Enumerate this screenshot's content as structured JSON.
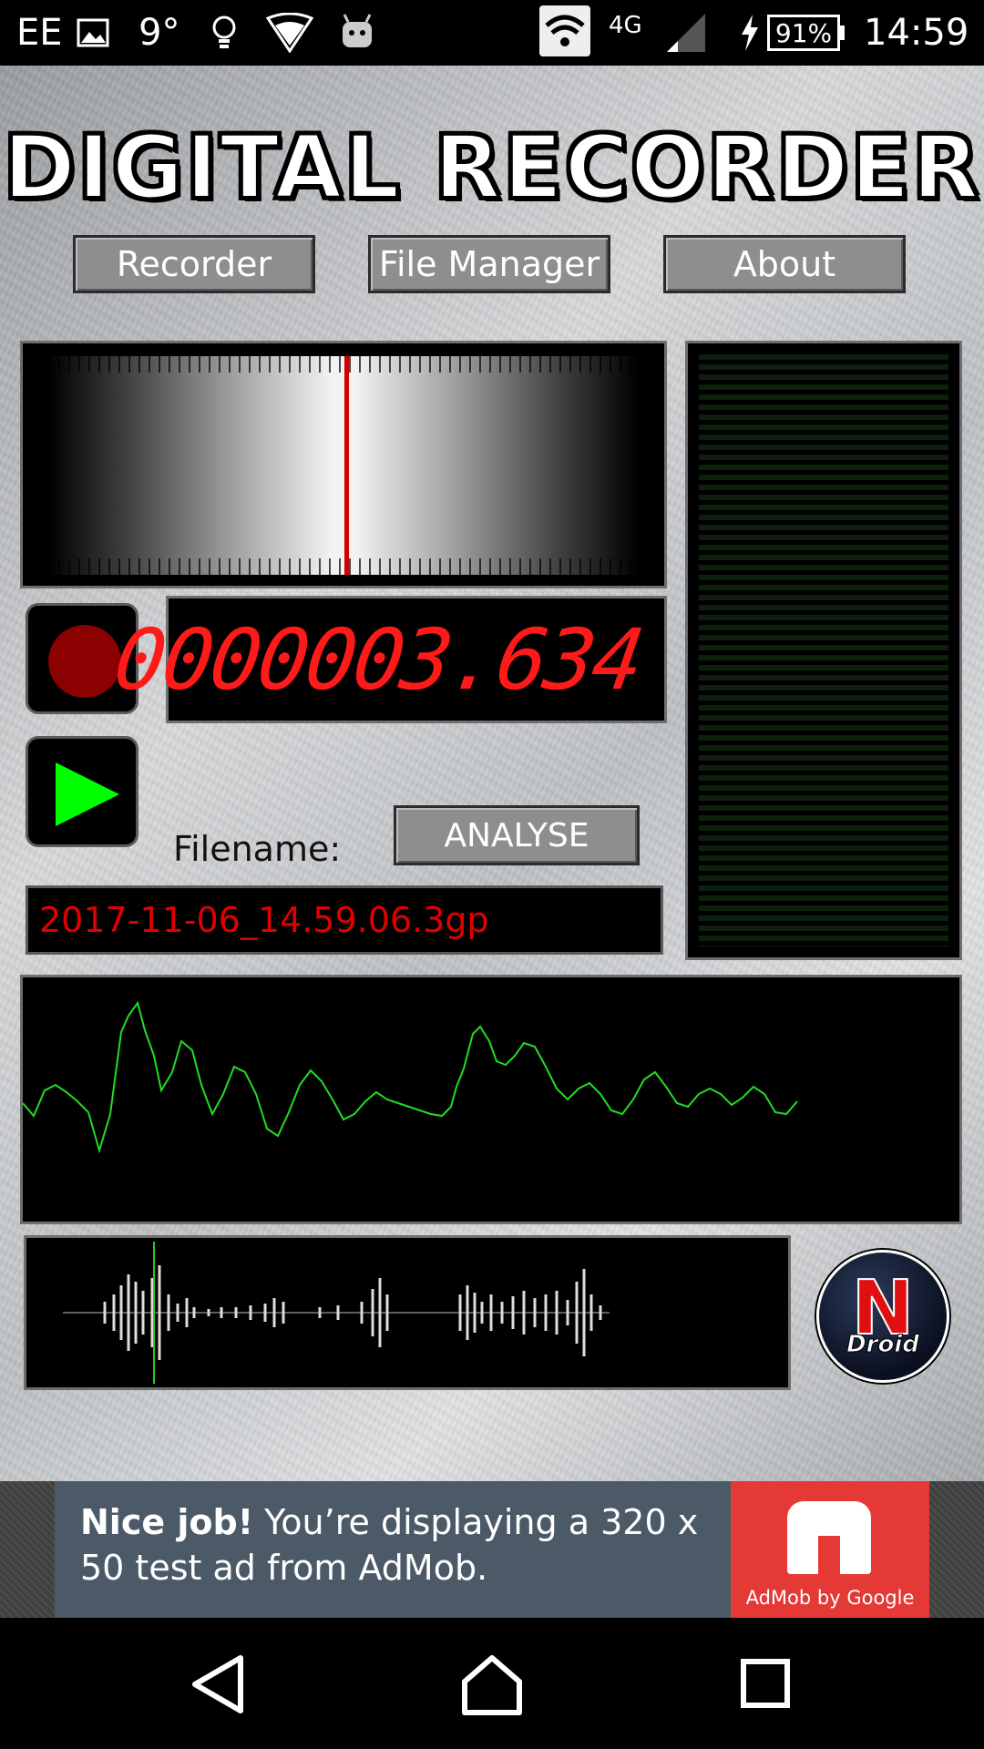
{
  "status_bar": {
    "carrier": "EE",
    "temperature": "9°",
    "network": "4G",
    "battery": "91%",
    "time": "14:59"
  },
  "app": {
    "title": "DIGITAL RECORDER",
    "nav": {
      "recorder": "Recorder",
      "file_manager": "File Manager",
      "about": "About"
    },
    "counter": "0000003.634",
    "filename_label": "Filename:",
    "analyse": "ANALYSE",
    "filename": "2017-11-06_14.59.06.3gp",
    "logo": {
      "letter": "N",
      "word": "Droid"
    }
  },
  "ad": {
    "headline": "Nice job!",
    "body": "You’re displaying a 320 x 50 test ad from AdMob.",
    "brand": "AdMob by Google"
  },
  "colors": {
    "counter": "#ff1a1a",
    "filename": "#e00000",
    "waveform": "#22dd22",
    "record": "#8b0000",
    "play": "#00ff00",
    "ad_brand": "#e53935"
  }
}
